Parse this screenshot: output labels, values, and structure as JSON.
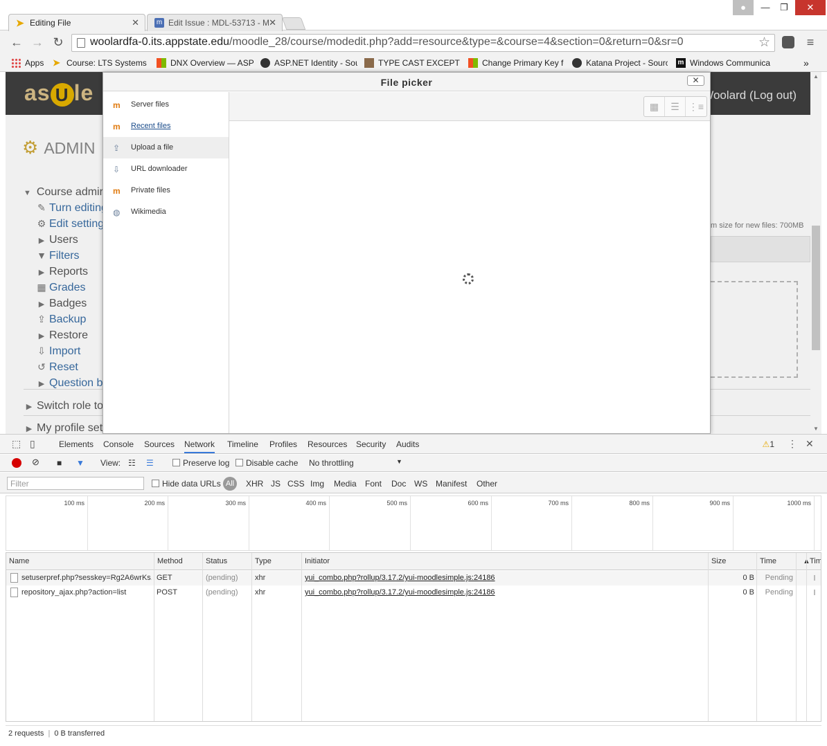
{
  "browser": {
    "tabs": [
      {
        "title": "Editing File",
        "active": true
      },
      {
        "title": "Edit Issue : MDL-53713 - M",
        "active": false
      }
    ],
    "url": {
      "host": "woolardfa-0.its.appstate.edu",
      "path": "/moodle_28/course/modedit.php?add=resource&type=&course=4&section=0&return=0&sr=0"
    },
    "bookmarks": [
      {
        "label": "Apps",
        "icon": "apps-grid-icon"
      },
      {
        "label": "Course: LTS Systems &",
        "icon": "moodle-icon"
      },
      {
        "label": "DNX Overview — ASP",
        "icon": "windows-icon"
      },
      {
        "label": "ASP.NET Identity - Sou",
        "icon": "github-icon"
      },
      {
        "label": "TYPE CAST EXCEPTION",
        "icon": "avatar-icon"
      },
      {
        "label": "Change Primary Key fo",
        "icon": "windows-icon"
      },
      {
        "label": "Katana Project - Sourc",
        "icon": "github-icon"
      },
      {
        "label": "Windows Communica",
        "icon": "m-icon"
      }
    ],
    "bookmarks_overflow": "»"
  },
  "page": {
    "logo": {
      "left": "as",
      "middle": "U",
      "right": "le"
    },
    "logout": "Woolard (Log out)",
    "admin_heading": "ADMIN",
    "course_admin": "Course admir",
    "admin_items": [
      {
        "label": "Turn editing",
        "icon": "pencil-icon",
        "style": "link"
      },
      {
        "label": "Edit setting",
        "icon": "gear-icon",
        "style": "link"
      },
      {
        "label": "Users",
        "icon": "caret-right-icon",
        "style": "plain"
      },
      {
        "label": "Filters",
        "icon": "filter-icon",
        "style": "link"
      },
      {
        "label": "Reports",
        "icon": "caret-right-icon",
        "style": "plain"
      },
      {
        "label": "Grades",
        "icon": "table-icon",
        "style": "link"
      },
      {
        "label": "Badges",
        "icon": "caret-right-icon",
        "style": "plain"
      },
      {
        "label": "Backup",
        "icon": "upload-icon",
        "style": "link"
      },
      {
        "label": "Restore",
        "icon": "caret-right-icon",
        "style": "plain"
      },
      {
        "label": "Import",
        "icon": "download-icon",
        "style": "link"
      },
      {
        "label": "Reset",
        "icon": "reset-icon",
        "style": "link"
      },
      {
        "label": "Question b",
        "icon": "caret-right-icon",
        "style": "link"
      }
    ],
    "switch_role": "Switch role to",
    "my_profile": "My profile set",
    "max_size": "m size for new files: 700MB"
  },
  "filepicker": {
    "title": "File picker",
    "close": "✕",
    "repositories": [
      {
        "label": "Server files",
        "icon": "moodle-icon",
        "style": "plain",
        "selected": false
      },
      {
        "label": "Recent files",
        "icon": "moodle-icon",
        "style": "link",
        "selected": false
      },
      {
        "label": "Upload a file",
        "icon": "upload-file-icon",
        "style": "plain",
        "selected": true
      },
      {
        "label": "URL downloader",
        "icon": "url-download-icon",
        "style": "plain",
        "selected": false
      },
      {
        "label": "Private files",
        "icon": "moodle-icon",
        "style": "plain",
        "selected": false
      },
      {
        "label": "Wikimedia",
        "icon": "wikimedia-icon",
        "style": "plain",
        "selected": false
      }
    ]
  },
  "devtools": {
    "tabs": [
      "Elements",
      "Console",
      "Sources",
      "Network",
      "Timeline",
      "Profiles",
      "Resources",
      "Security",
      "Audits"
    ],
    "active_tab": "Network",
    "warnings": "1",
    "view_label": "View:",
    "preserve_log": "Preserve log",
    "disable_cache": "Disable cache",
    "throttling": "No throttling",
    "filter_placeholder": "Filter",
    "hide_data_urls": "Hide data URLs",
    "type_filters": [
      "All",
      "XHR",
      "JS",
      "CSS",
      "Img",
      "Media",
      "Font",
      "Doc",
      "WS",
      "Manifest",
      "Other"
    ],
    "timeline_ticks": [
      "100 ms",
      "200 ms",
      "300 ms",
      "400 ms",
      "500 ms",
      "600 ms",
      "700 ms",
      "800 ms",
      "900 ms",
      "1000 ms"
    ],
    "columns": [
      "Name",
      "Method",
      "Status",
      "Type",
      "Initiator",
      "Size",
      "Time",
      "Time"
    ],
    "requests": [
      {
        "name": "setuserpref.php?sesskey=Rg2A6wrKs...",
        "method": "GET",
        "status": "(pending)",
        "type": "xhr",
        "initiator": "yui_combo.php?rollup/3.17.2/yui-moodlesimple.js:24186",
        "size": "0 B",
        "time": "Pending"
      },
      {
        "name": "repository_ajax.php?action=list",
        "method": "POST",
        "status": "(pending)",
        "type": "xhr",
        "initiator": "yui_combo.php?rollup/3.17.2/yui-moodlesimple.js:24186",
        "size": "0 B",
        "time": "Pending"
      }
    ],
    "summary_requests": "2 requests",
    "summary_separator": "|",
    "summary_transferred": "0 B transferred"
  }
}
